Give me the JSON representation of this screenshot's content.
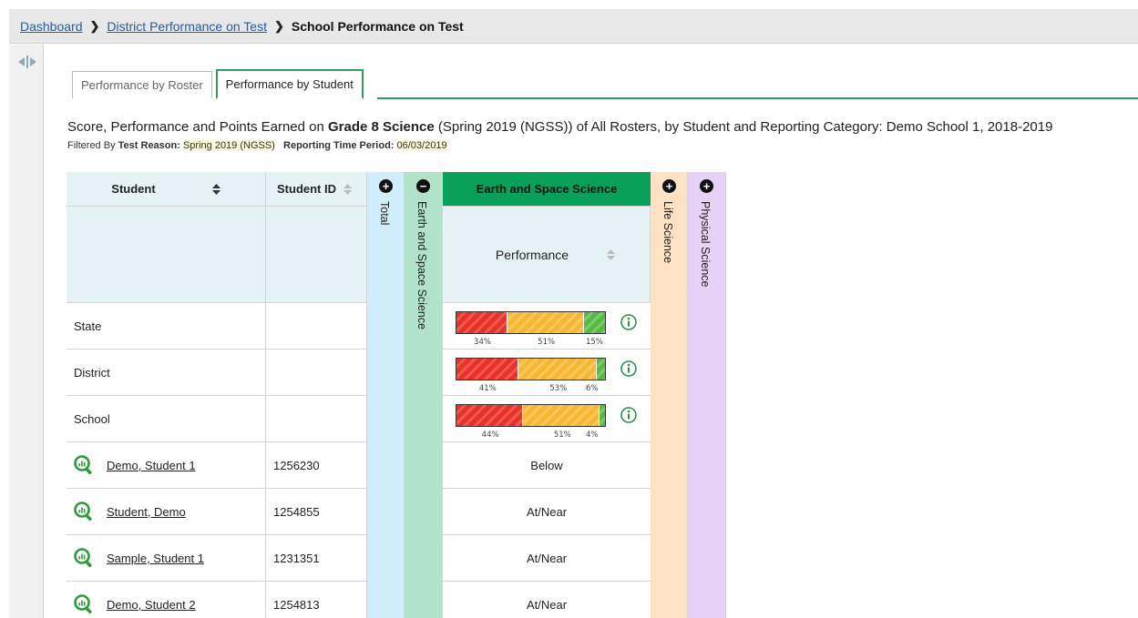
{
  "breadcrumb": {
    "items": [
      "Dashboard",
      "District Performance on Test"
    ],
    "current": "School Performance on Test"
  },
  "tabs": [
    {
      "label": "Performance by Roster",
      "active": false
    },
    {
      "label": "Performance by Student",
      "active": true
    }
  ],
  "report": {
    "title_prefix": "Score, Performance and Points Earned on ",
    "title_bold": "Grade 8 Science",
    "title_suffix": " (Spring 2019 (NGSS)) of All Rosters, by Student and Reporting Category: Demo School 1, 2018-2019",
    "filter_prefix": "Filtered By ",
    "filter_reason_label": "Test Reason:",
    "filter_reason_value": "Spring 2019 (NGSS)",
    "filter_period_label": "Reporting Time Period:",
    "filter_period_value": "06/03/2019"
  },
  "table": {
    "columns": {
      "student": "Student",
      "student_id": "Student ID",
      "total": "Total",
      "earth_collapsed": "Earth and Space Science",
      "earth_header": "Earth and Space Science",
      "earth_sub": "Performance",
      "life": "Life Science",
      "physical": "Physical Science"
    },
    "summary_rows": [
      {
        "label": "State",
        "values": [
          34,
          51,
          15
        ],
        "labels": [
          "34%",
          "51%",
          "15%"
        ]
      },
      {
        "label": "District",
        "values": [
          41,
          53,
          6
        ],
        "labels": [
          "41%",
          "53%",
          "6%"
        ]
      },
      {
        "label": "School",
        "values": [
          44,
          51,
          4
        ],
        "labels": [
          "44%",
          "51%",
          "4%"
        ]
      }
    ],
    "students": [
      {
        "name": "Demo, Student 1",
        "id": "1256230",
        "performance": "Below"
      },
      {
        "name": "Student, Demo",
        "id": "1254855",
        "performance": "At/Near"
      },
      {
        "name": "Sample, Student 1",
        "id": "1231351",
        "performance": "At/Near"
      },
      {
        "name": "Demo, Student 2",
        "id": "1254813",
        "performance": "At/Near"
      }
    ]
  },
  "colors": {
    "accent_green": "#3a9a5b",
    "earth_header": "#08a05a",
    "total_col": "#cfeefa",
    "earth_col": "#b2e3c8",
    "life_col": "#fde2c4",
    "physical_col": "#e6d2f7",
    "header_bg": "#e6f3f6"
  }
}
